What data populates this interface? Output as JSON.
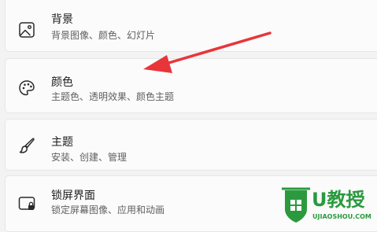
{
  "settings": {
    "items": [
      {
        "title": "背景",
        "description": "背景图像、颜色、幻灯片",
        "icon": "image-icon"
      },
      {
        "title": "颜色",
        "description": "主题色、透明效果、颜色主题",
        "icon": "palette-icon"
      },
      {
        "title": "主题",
        "description": "安装、创建、管理",
        "icon": "brush-icon"
      },
      {
        "title": "锁屏界面",
        "description": "锁定屏幕图像、应用和动画",
        "icon": "lock-screen-icon"
      }
    ]
  },
  "annotation": {
    "arrow_color": "#e8353a"
  },
  "watermark": {
    "brand": "U教授",
    "site": "UJIAOSHOU.COM",
    "color": "#2b9a3f"
  }
}
